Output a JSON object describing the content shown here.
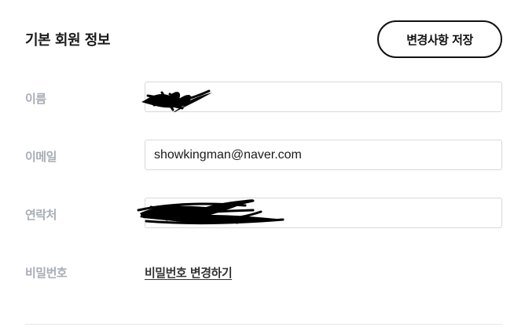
{
  "section": {
    "title": "기본 회원 정보",
    "save_label": "변경사항 저장"
  },
  "fields": {
    "name": {
      "label": "이름",
      "value": "",
      "redacted": true
    },
    "email": {
      "label": "이메일",
      "value": "showkingman@naver.com"
    },
    "phone": {
      "label": "연락처",
      "value": "",
      "redacted": true
    },
    "password": {
      "label": "비밀번호",
      "link_label": "비밀번호 변경하기"
    }
  },
  "colors": {
    "label": "#a7adb5",
    "border": "#d9d9d9",
    "text": "#1a1a1a",
    "button_border": "#111111"
  }
}
